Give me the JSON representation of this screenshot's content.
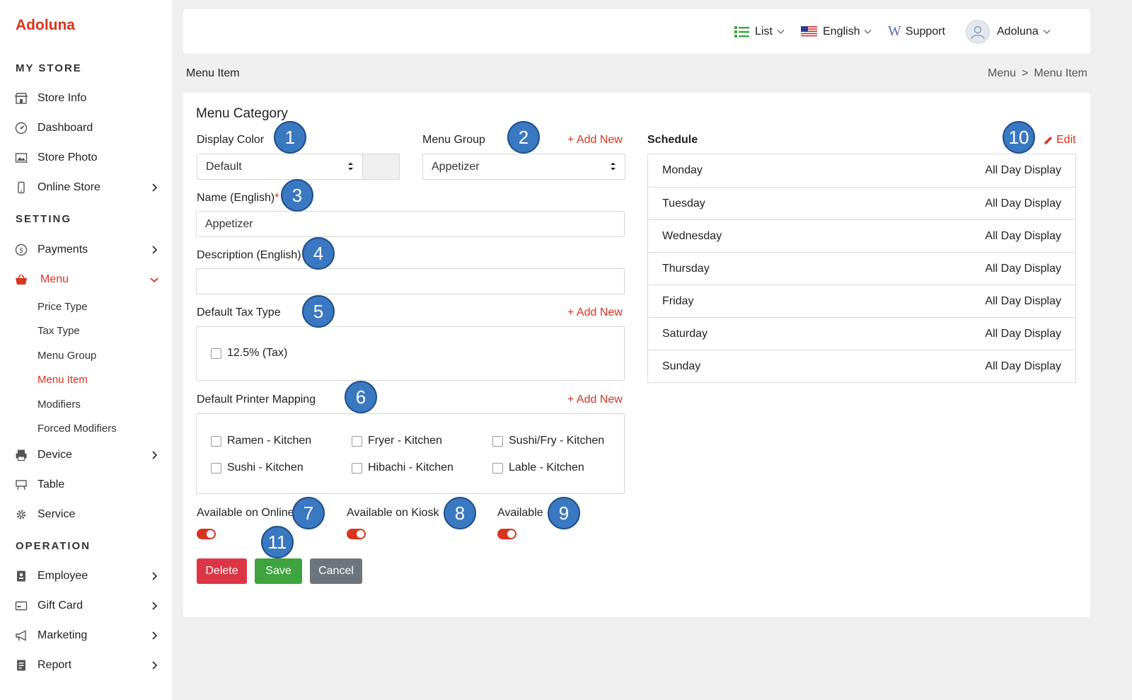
{
  "brand": "Adoluna",
  "sidebar": {
    "my_store_heading": "MY STORE",
    "setting_heading": "SETTING",
    "operation_heading": "OPERATION",
    "store_info": "Store Info",
    "dashboard": "Dashboard",
    "store_photo": "Store Photo",
    "online_store": "Online Store",
    "payments": "Payments",
    "menu": "Menu",
    "menu_sub": {
      "price_type": "Price Type",
      "tax_type": "Tax Type",
      "menu_group": "Menu Group",
      "menu_item": "Menu Item",
      "modifiers": "Modifiers",
      "forced_modifiers": "Forced Modifiers"
    },
    "device": "Device",
    "table": "Table",
    "service": "Service",
    "employee": "Employee",
    "gift_card": "Gift Card",
    "marketing": "Marketing",
    "report": "Report"
  },
  "topbar": {
    "list": "List",
    "language": "English",
    "support": "Support",
    "user": "Adoluna"
  },
  "page": {
    "title": "Menu Item",
    "breadcrumb": [
      "Menu",
      ">",
      "Menu Item"
    ]
  },
  "form": {
    "card_title": "Menu Category",
    "display_color_label": "Display Color",
    "display_color_value": "Default",
    "menu_group_label": "Menu Group",
    "menu_group_value": "Appetizer",
    "add_new": "+ Add New",
    "name_label": "Name (English)",
    "name_required": "*",
    "name_value": "Appetizer",
    "description_label": "Description (English)",
    "description_value": "",
    "tax_label": "Default Tax Type",
    "tax_option": "12.5% (Tax)",
    "printer_label": "Default Printer Mapping",
    "printers": [
      "Ramen -  Kitchen",
      "Fryer -  Kitchen",
      "Sushi/Fry -  Kitchen",
      "Sushi -  Kitchen",
      "Hibachi -  Kitchen",
      "Lable -  Kitchen"
    ],
    "available_online": "Available on Online",
    "available_kiosk": "Available on Kiosk",
    "available": "Available",
    "delete": "Delete",
    "save": "Save",
    "cancel": "Cancel"
  },
  "schedule": {
    "label": "Schedule",
    "edit": "Edit",
    "rows": [
      {
        "day": "Monday",
        "value": "All Day Display"
      },
      {
        "day": "Tuesday",
        "value": "All Day Display"
      },
      {
        "day": "Wednesday",
        "value": "All Day Display"
      },
      {
        "day": "Thursday",
        "value": "All Day Display"
      },
      {
        "day": "Friday",
        "value": "All Day Display"
      },
      {
        "day": "Saturday",
        "value": "All Day Display"
      },
      {
        "day": "Sunday",
        "value": "All Day Display"
      }
    ]
  },
  "annotations": [
    "1",
    "2",
    "3",
    "4",
    "5",
    "6",
    "7",
    "8",
    "9",
    "10",
    "11"
  ],
  "colors": {
    "accent": "#d9331f",
    "badge": "#3a78c2",
    "save": "#3fa33f",
    "delete": "#dc3545",
    "cancel": "#6c757d"
  },
  "icons": {
    "list": "list-icon",
    "flag": "us-flag-icon",
    "support": "support-w-icon",
    "avatar": "user-avatar-icon"
  }
}
